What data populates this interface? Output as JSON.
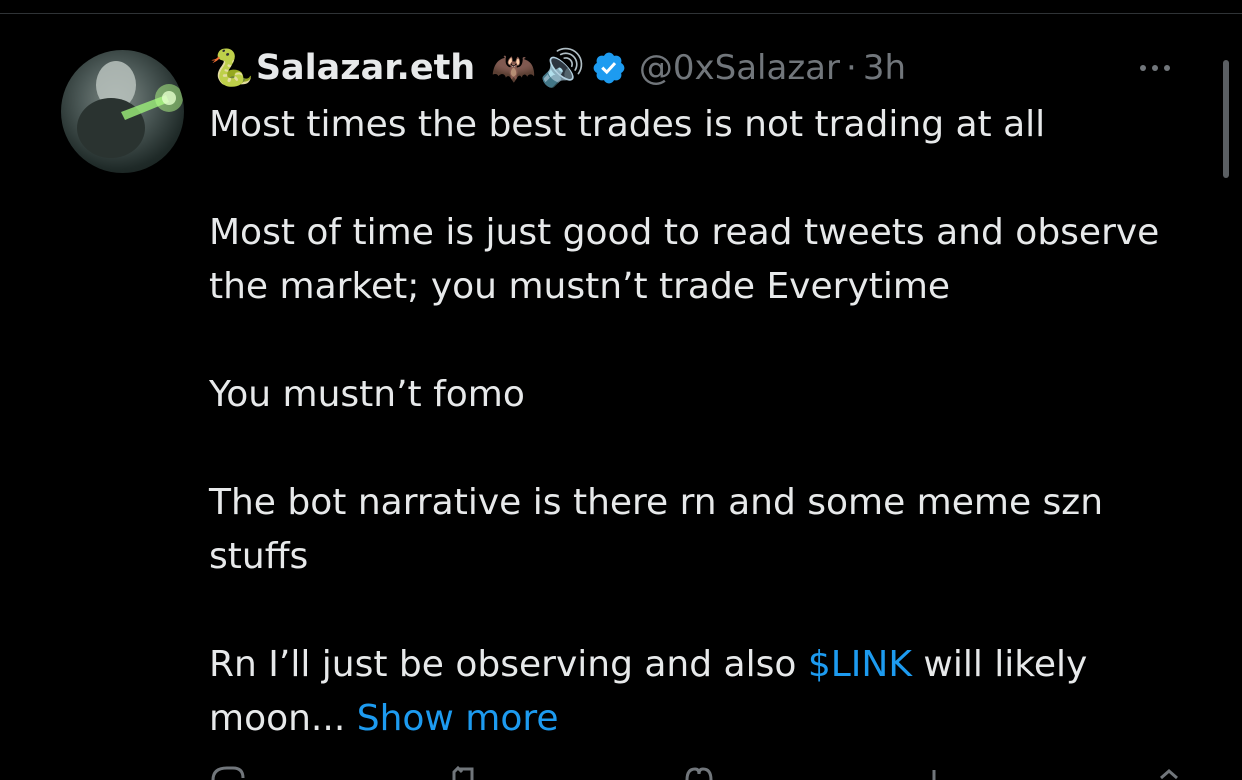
{
  "author": {
    "name_emoji": "🐍",
    "display_name": "Salazar.eth",
    "badges": [
      "🦇",
      "🔊"
    ],
    "verified": true,
    "handle": "@0xSalazar",
    "separator": "·",
    "time": "3h"
  },
  "tweet": {
    "line1": "Most times the best trades is not trading at all",
    "line2": "Most of time is just good to read tweets and observe the market; you mustn’t trade Everytime",
    "line3": "You mustn’t fomo",
    "line4": "The bot narrative is there rn and some meme szn stuffs",
    "line5_before": "Rn I’ll just be observing and also ",
    "cashtag": "$LINK",
    "line5_after": " will likely moon...",
    "show_more": "Show more"
  },
  "actions": [
    "reply-icon",
    "retweet-icon",
    "like-icon",
    "views-icon",
    "share-icon"
  ],
  "colors": {
    "background": "#000000",
    "text": "#e7e9ea",
    "secondary": "#71767b",
    "accent": "#1d9bf0"
  }
}
